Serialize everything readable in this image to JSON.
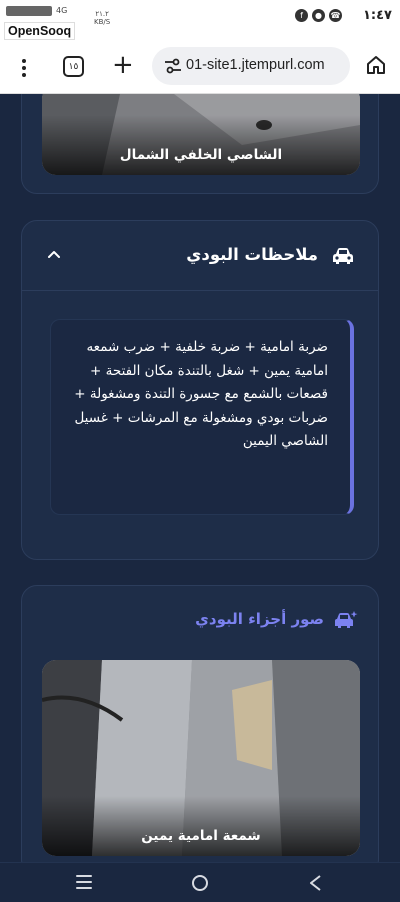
{
  "status_bar": {
    "time": "١:٤٧",
    "network": "4G",
    "speed_value": "٢١.٢",
    "speed_unit": "KB/S",
    "app_badge": "OpenSooq"
  },
  "browser": {
    "tab_count": "١٥",
    "url": "01-site1.jtempurl.com"
  },
  "photo_top": {
    "caption": "الشاصي الخلفي الشمال"
  },
  "notes_card": {
    "title": "ملاحظات البودي",
    "text": "ضربة امامية + ضربة خلفية + ضرب شمعه امامية يمين + شغل بالتندة مكان الفتحة + قصعات بالشمع مع جسورة التندة ومشغولة + ضربات بودي ومشغولة مع المرشات + غسيل الشاصي اليمين"
  },
  "photos_card": {
    "title": "صور أجزاء البودي",
    "photo_caption": "شمعة امامية يمين"
  },
  "colors": {
    "background": "#1a2740",
    "card": "#1e2d48",
    "accent": "#6b72e0",
    "accent_text": "#7c82f0"
  },
  "icons": [
    "more-vert-icon",
    "tabs-icon",
    "plus-icon",
    "site-settings-icon",
    "home-icon",
    "car-icon",
    "chevron-up-icon",
    "car-search-icon",
    "nav-menu-icon",
    "nav-home-icon",
    "nav-back-icon"
  ]
}
